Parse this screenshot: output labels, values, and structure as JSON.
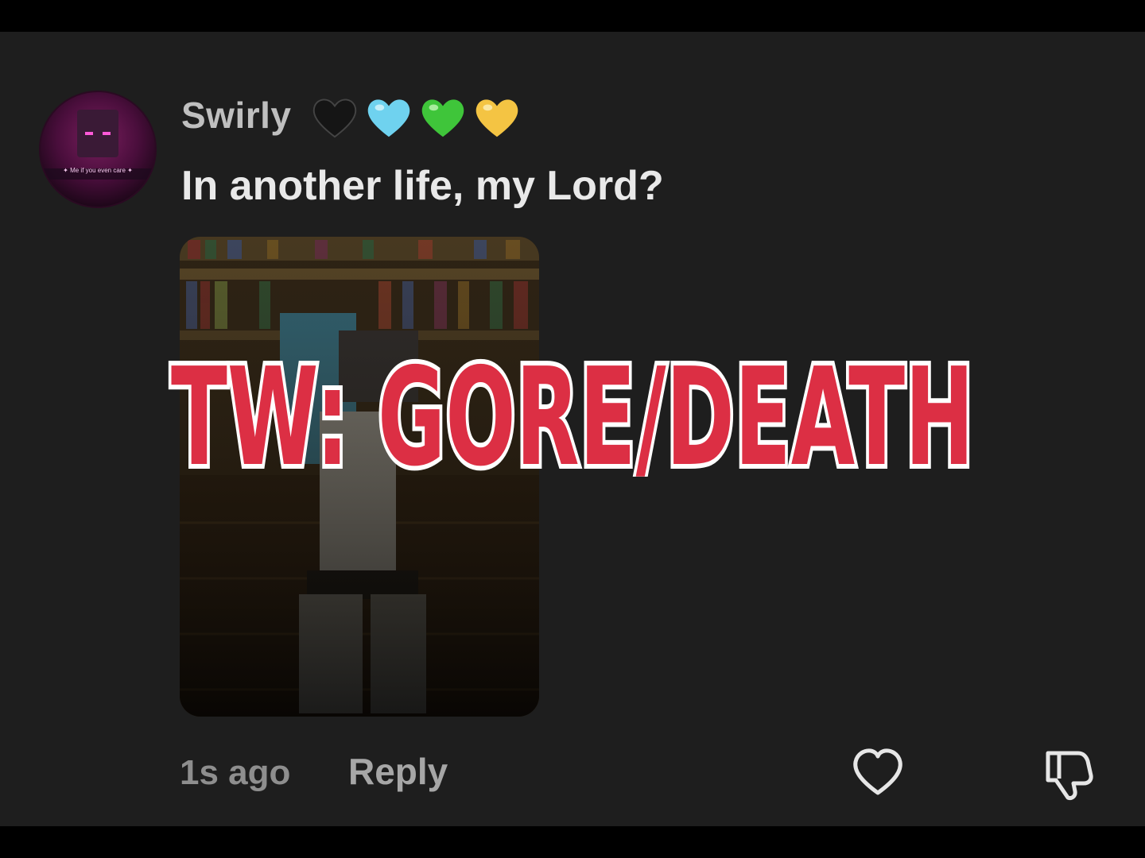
{
  "comment": {
    "username": "Swirly",
    "username_emojis": [
      "black-heart",
      "light-blue-heart",
      "green-heart",
      "yellow-heart"
    ],
    "text": "In another life, my Lord?",
    "avatar_caption": "✦ Me if you even care ✦",
    "timestamp": "1s ago",
    "reply_label": "Reply"
  },
  "overlay": {
    "warning_text": "TW: GORE/DEATH",
    "warning_color": "#dc2f44"
  },
  "icons": {
    "like": "heart-outline-icon",
    "dislike": "thumbs-down-icon"
  }
}
